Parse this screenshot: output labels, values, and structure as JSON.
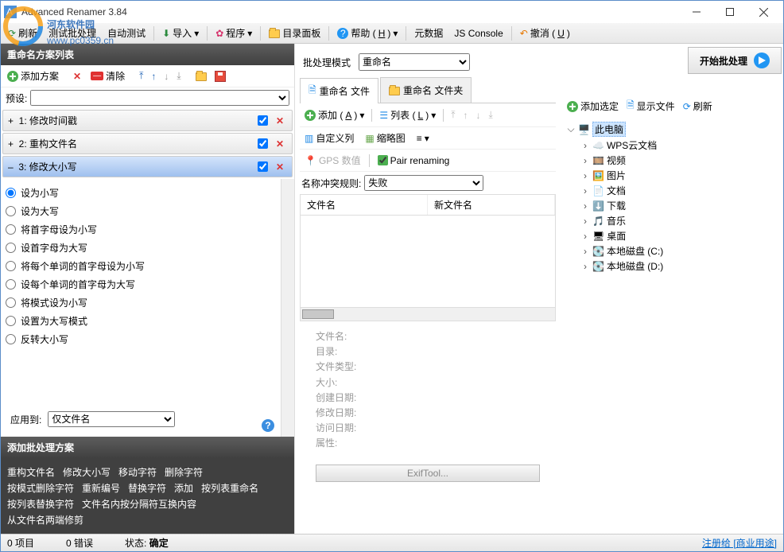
{
  "window": {
    "title": "Advanced Renamer 3.84"
  },
  "menubar": {
    "refresh": "刷新",
    "test": "测试批处理",
    "autotest": "自动测试",
    "import": "导入",
    "program": "程序",
    "dirpanel": "目录面板",
    "help": "帮助 (",
    "help_key": "H",
    "help_suffix": ")",
    "metadata": "元数据",
    "jsconsole": "JS Console",
    "undo": "撤消 (",
    "undo_key": "U",
    "undo_suffix": ")"
  },
  "left": {
    "header": "重命名方案列表",
    "add_method": "添加方案",
    "clear": "清除",
    "preset_label": "预设:",
    "methods": [
      {
        "idx": "1",
        "name": "修改时间戳",
        "checked": true
      },
      {
        "idx": "2",
        "name": "重构文件名",
        "checked": true
      },
      {
        "idx": "3",
        "name": "修改大小写",
        "checked": true
      }
    ],
    "case_options": [
      "设为小写",
      "设为大写",
      "将首字母设为小写",
      "设首字母为大写",
      "将每个单词的首字母设为小写",
      "设每个单词的首字母为大写",
      "将模式设为小写",
      "设置为大写模式",
      "反转大小写"
    ],
    "apply_to_label": "应用到:",
    "apply_to_value": "仅文件名",
    "add_header": "添加批处理方案",
    "link_rows": [
      [
        "重构文件名",
        "修改大小写",
        "移动字符",
        "删除字符"
      ],
      [
        "按模式删除字符",
        "重新编号",
        "替换字符",
        "添加",
        "按列表重命名"
      ],
      [
        "按列表替换字符",
        "文件名内按分隔符互换内容"
      ],
      [
        "从文件名两端修剪"
      ]
    ]
  },
  "center": {
    "batch_label": "批处理模式",
    "batch_value": "重命名",
    "start": "开始批处理",
    "tabs": {
      "files": "重命名 文件",
      "folders": "重命名 文件夹"
    },
    "add": "添加 (",
    "add_key": "A",
    "add_suffix": ")",
    "list": "列表 (",
    "list_key": "L",
    "list_suffix": ")",
    "custom_cols": "自定义列",
    "thumbnails": "缩略图",
    "gps_placeholder": "GPS 数值",
    "pair": "Pair renaming",
    "conflict_label": "名称冲突规则:",
    "conflict_value": "失败",
    "th_name": "文件名",
    "th_newname": "新文件名",
    "details": {
      "filename": "文件名:",
      "dir": "目录:",
      "filetype": "文件类型:",
      "size": "大小:",
      "created": "创建日期:",
      "modified": "修改日期:",
      "accessed": "访问日期:",
      "attrs": "属性:"
    },
    "exif": "ExifTool..."
  },
  "right": {
    "add_selected": "添加选定",
    "show_files": "显示文件",
    "refresh": "刷新",
    "tree": [
      {
        "d": 0,
        "exp": "v",
        "icon": "pc",
        "label": "此电脑",
        "selected": true
      },
      {
        "d": 1,
        "exp": ">",
        "icon": "cloud",
        "label": "WPS云文档"
      },
      {
        "d": 1,
        "exp": ">",
        "icon": "video",
        "label": "视频"
      },
      {
        "d": 1,
        "exp": ">",
        "icon": "pic",
        "label": "图片"
      },
      {
        "d": 1,
        "exp": ">",
        "icon": "doc",
        "label": "文档"
      },
      {
        "d": 1,
        "exp": ">",
        "icon": "down",
        "label": "下载"
      },
      {
        "d": 1,
        "exp": ">",
        "icon": "music",
        "label": "音乐"
      },
      {
        "d": 1,
        "exp": ">",
        "icon": "desk",
        "label": "桌面"
      },
      {
        "d": 1,
        "exp": ">",
        "icon": "disk",
        "label": "本地磁盘 (C:)"
      },
      {
        "d": 1,
        "exp": ">",
        "icon": "disk",
        "label": "本地磁盘 (D:)"
      }
    ]
  },
  "status": {
    "items": "0 项目",
    "errors": "0 错误",
    "state_label": "状态:",
    "state": "确定",
    "register": "注册给 [商业用途]"
  },
  "watermark": {
    "brand": "河东软件园",
    "url": "www.pc0359.cn"
  }
}
